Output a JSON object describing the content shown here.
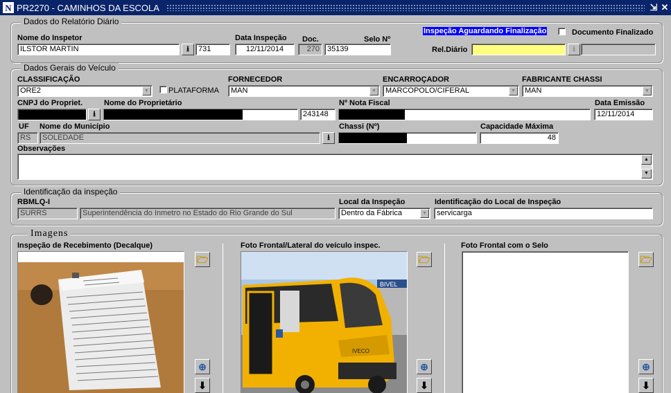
{
  "window": {
    "title": "PR2270 - CAMINHOS DA ESCOLA",
    "app_icon": "N"
  },
  "relatorio": {
    "group_title": "Dados do Relatório Diário",
    "inspetor_label": "Nome do Inspetor",
    "inspetor_value": "ILSTOR MARTIN",
    "inspetor_code": "731",
    "data_label": "Data Inspeção",
    "data_value": "12/11/2014",
    "doc_label": "Doc.",
    "doc_value": "270",
    "selo_label": "Selo Nº",
    "selo_value": "35139",
    "status_text": "Inspeção Aguardando Finalização",
    "finalizado_label": "Documento Finalizado",
    "rel_label": "Rel.Diário"
  },
  "veiculo": {
    "group_title": "Dados Gerais do Veículo",
    "classificacao_label": "CLASSIFICAÇÃO",
    "classificacao_value": "ORE2",
    "plataforma_label": "PLATAFORMA",
    "fornecedor_label": "FORNECEDOR",
    "fornecedor_value": "MAN",
    "encarrocador_label": "ENCARROÇADOR",
    "encarrocador_value": "MARCOPOLO/CIFERAL",
    "fabricante_label": "FABRICANTE CHASSI",
    "fabricante_value": "MAN",
    "cnpj_label": "CNPJ do Propriet.",
    "proprietario_label": "Nome do Proprietário",
    "proprietario_code": "243148",
    "nota_label": "Nº Nota Fiscal",
    "emissao_label": "Data Emissão",
    "emissao_value": "12/11/2014",
    "uf_label": "UF",
    "uf_value": "RS",
    "municipio_label": "Nome do Município",
    "municipio_value": "SOLEDADE",
    "chassi_label": "Chassi (Nº)",
    "capacidade_label": "Capacidade Máxima",
    "capacidade_value": "48",
    "obs_label": "Observações"
  },
  "identificacao": {
    "group_title": "Identificação da inspeção",
    "rbmlq_label": "RBMLQ-I",
    "rbmlq_code": "SURRS",
    "rbmlq_name": "Superintendência do Inmetro no Estado do Rio Grande do Sul",
    "local_label": "Local da Inspeção",
    "local_value": "Dentro da Fábrica",
    "id_local_label": "Identificação do Local de Inspeção",
    "id_local_value": "servicarga"
  },
  "imagens": {
    "group_title": "Imagens",
    "img1_label": "Inspeção de Recebimento  (Decalque)",
    "img2_label": "Foto Frontal/Lateral do veículo inspec.",
    "img3_label": "Foto Frontal com o Selo",
    "bus_sign": "BIVEL",
    "bus_brand": "IVECO"
  },
  "icons": {
    "folder": "folder-open-icon",
    "zoom": "zoom-in-icon",
    "download": "download-arrow-icon"
  },
  "colors": {
    "title_bar": "#0a246a",
    "status_highlight": "#0000ff",
    "rel_field": "#ffff80",
    "bus": "#f2b100"
  }
}
